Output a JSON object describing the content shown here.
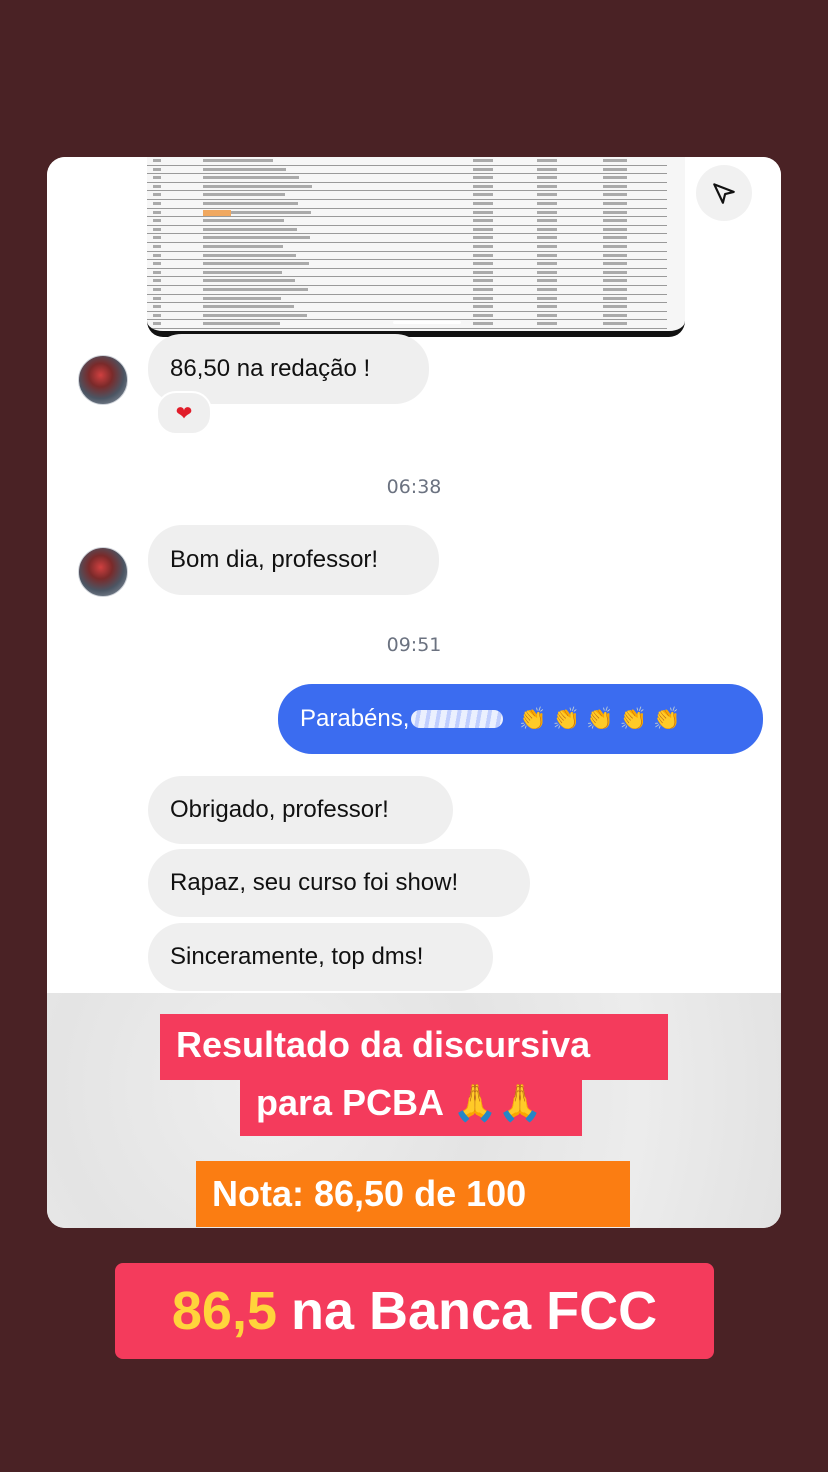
{
  "chat": {
    "messages": [
      {
        "text": "86,50 na redação !",
        "reaction": "❤"
      },
      {
        "text": "Bom dia, professor!"
      },
      {
        "text": "Parabéns,",
        "claps": "👏👏👏👏👏"
      },
      {
        "text": "Obrigado, professor!"
      },
      {
        "text": "Rapaz, seu curso foi show!"
      },
      {
        "text": "Sinceramente, top dms!"
      }
    ],
    "timestamps": [
      "06:38",
      "09:51"
    ]
  },
  "overlay": {
    "line1": "Resultado da discursiva",
    "line2": "para PCBA 🙏🙏",
    "score": "Nota: 86,50 de 100"
  },
  "banner": {
    "number": "86,5",
    "text": "na Banca FCC"
  },
  "colors": {
    "background": "#4a2225",
    "outgoing_bubble": "#3b6cf0",
    "incoming_bubble": "#efefef",
    "tag_red": "#f43b5c",
    "tag_orange": "#fb7d12",
    "banner_number": "#ffd43b"
  },
  "icons": [
    "send-icon",
    "heart-icon",
    "clapping-hands-icon",
    "praying-hands-icon",
    "avatar"
  ]
}
